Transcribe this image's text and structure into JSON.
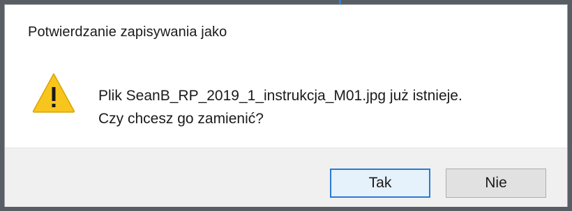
{
  "dialog": {
    "title": "Potwierdzanie zapisywania jako",
    "icon": "warning-icon",
    "message_line1": "Plik SeanB_RP_2019_1_instrukcja_M01.jpg już istnieje.",
    "message_line2": "Czy chcesz go zamienić?",
    "buttons": {
      "yes_label": "Tak",
      "no_label": "Nie"
    }
  },
  "colors": {
    "warning_fill": "#f7c51e",
    "focus_border": "#2b79d4",
    "button_bar": "#f0f0f0"
  }
}
